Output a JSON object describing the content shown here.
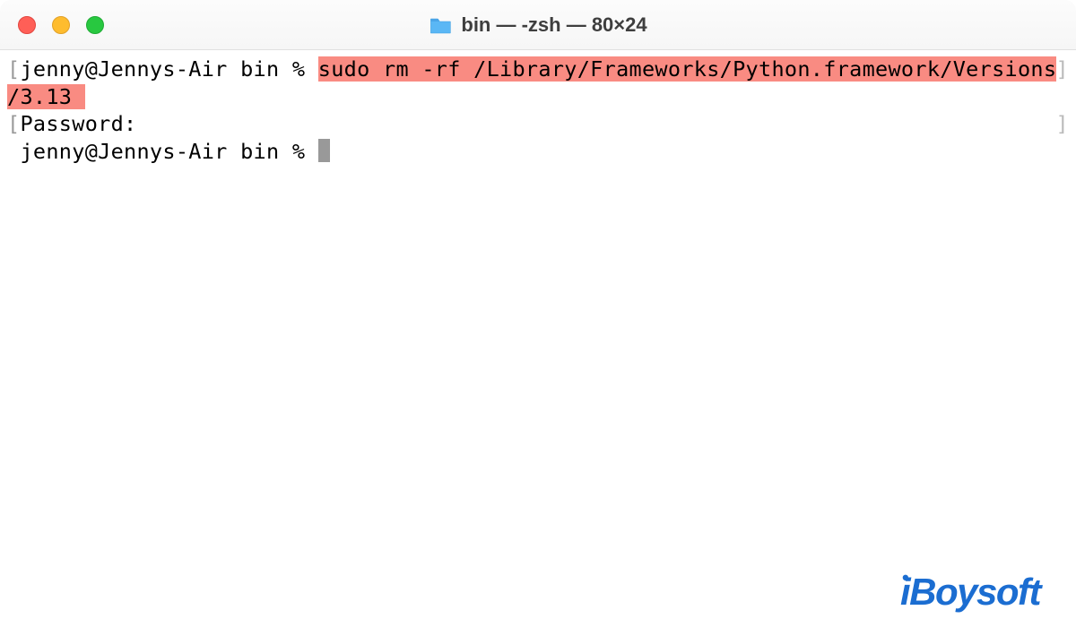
{
  "window": {
    "title": "bin — -zsh — 80×24"
  },
  "terminal": {
    "line1_prompt": "jenny@Jennys-Air bin % ",
    "line1_command_part1": "sudo rm -rf /Library/Frameworks/Python.framework/Versions",
    "line1_command_part2": "/3.13 ",
    "line2": "Password:",
    "line3_prompt": "jenny@Jennys-Air bin % "
  },
  "watermark": {
    "text": "iBoysoft"
  },
  "colors": {
    "highlight_bg": "#f98b82",
    "traffic_close": "#ff5f57",
    "traffic_min": "#febc2e",
    "traffic_max": "#28c840",
    "watermark_color": "#1b6dd1"
  }
}
